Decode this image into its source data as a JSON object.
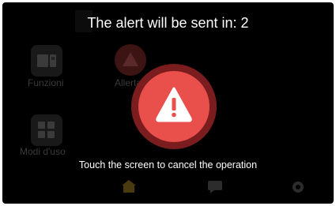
{
  "overlay": {
    "title": "The alert will be sent in: 2",
    "cancel_hint": "Touch the screen to cancel the operation"
  },
  "home": {
    "tiles": [
      {
        "label": "Funzioni",
        "icon": "functions-icon"
      },
      {
        "label": "Allerta",
        "icon": "alert-icon"
      },
      {
        "label": "Modi d'uso",
        "icon": "usage-modes-icon"
      }
    ],
    "bottom_nav": [
      "home-icon",
      "chat-icon",
      "settings-icon"
    ]
  },
  "colors": {
    "alert_red": "#e9504c",
    "alert_ring": "#7b1c1f",
    "background": "#000000",
    "text": "#ffffff"
  }
}
